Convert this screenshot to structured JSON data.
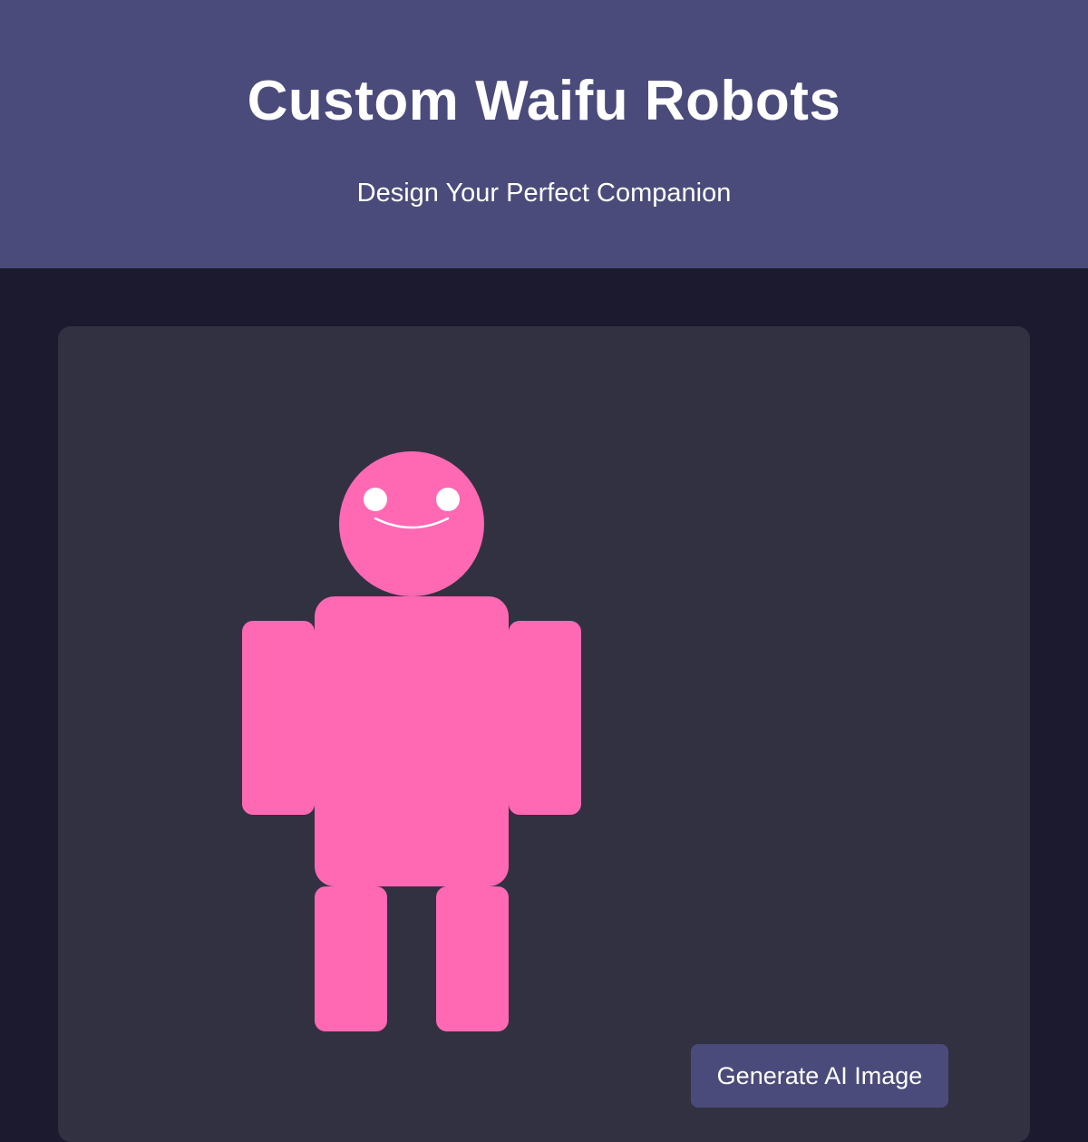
{
  "header": {
    "title": "Custom Waifu Robots",
    "subtitle": "Design Your Perfect Companion"
  },
  "robot": {
    "color": "#ff69b4",
    "eye_color": "#ffffff"
  },
  "actions": {
    "generate_label": "Generate AI Image"
  },
  "colors": {
    "header_bg": "#4b4b7b",
    "page_bg": "#1c1a2e",
    "panel_bg": "#323142",
    "button_bg": "#4b4b7b"
  }
}
